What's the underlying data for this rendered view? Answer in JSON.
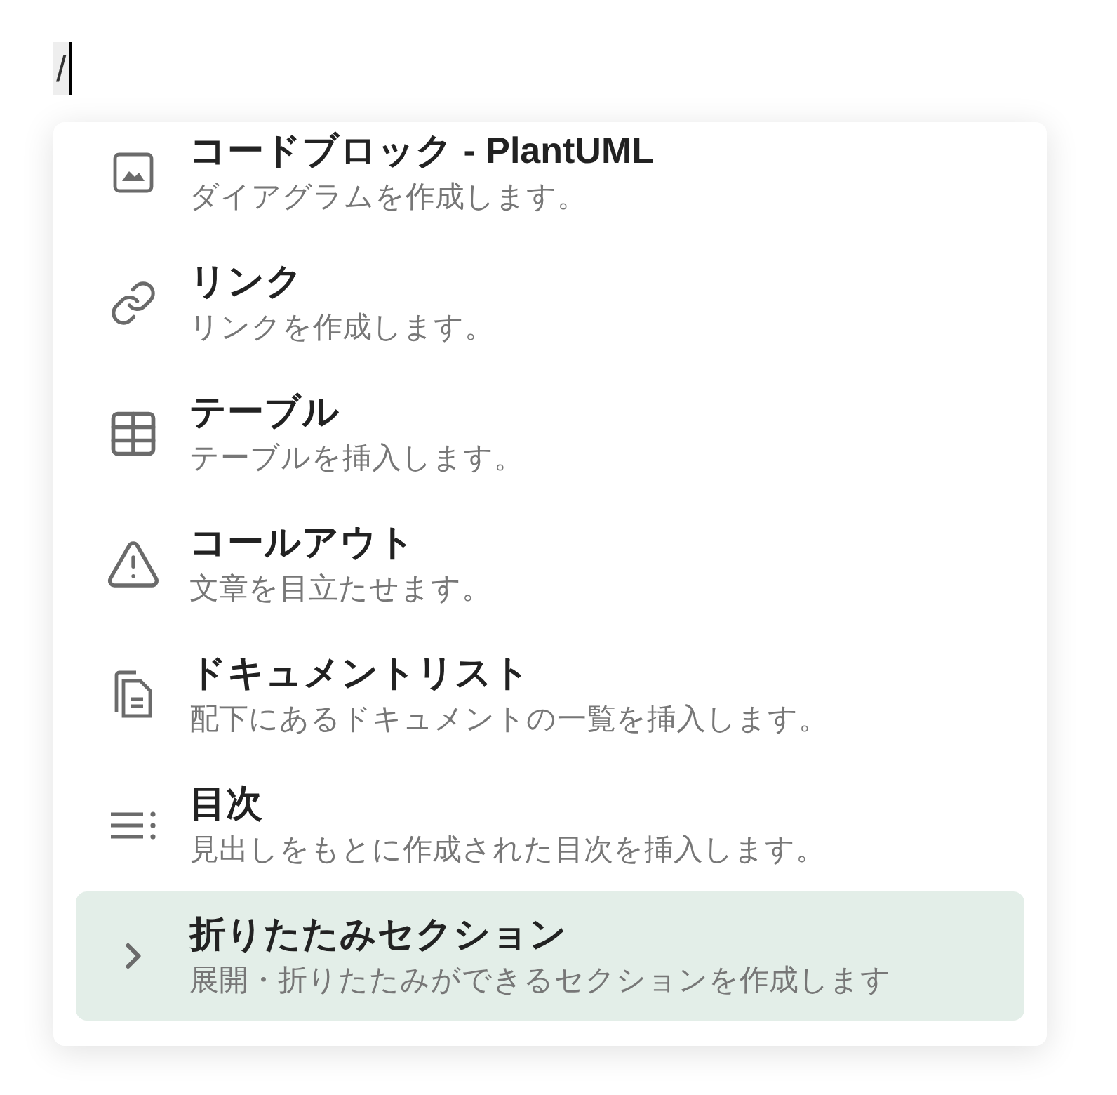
{
  "editor": {
    "text": "/"
  },
  "menu": {
    "items": [
      {
        "kind": "diagram",
        "title": "コードブロック - PlantUML",
        "description": "ダイアグラムを作成します。",
        "selected": false
      },
      {
        "kind": "link",
        "title": "リンク",
        "description": "リンクを作成します。",
        "selected": false
      },
      {
        "kind": "table",
        "title": "テーブル",
        "description": "テーブルを挿入します。",
        "selected": false
      },
      {
        "kind": "callout",
        "title": "コールアウト",
        "description": "文章を目立たせます。",
        "selected": false
      },
      {
        "kind": "doclist",
        "title": "ドキュメントリスト",
        "description": "配下にあるドキュメントの一覧を挿入します。",
        "selected": false
      },
      {
        "kind": "toc",
        "title": "目次",
        "description": "見出しをもとに作成された目次を挿入します。",
        "selected": false
      },
      {
        "kind": "section",
        "title": "折りたたみセクション",
        "description": "展開・折りたたみができるセクションを作成します",
        "selected": true
      }
    ]
  }
}
